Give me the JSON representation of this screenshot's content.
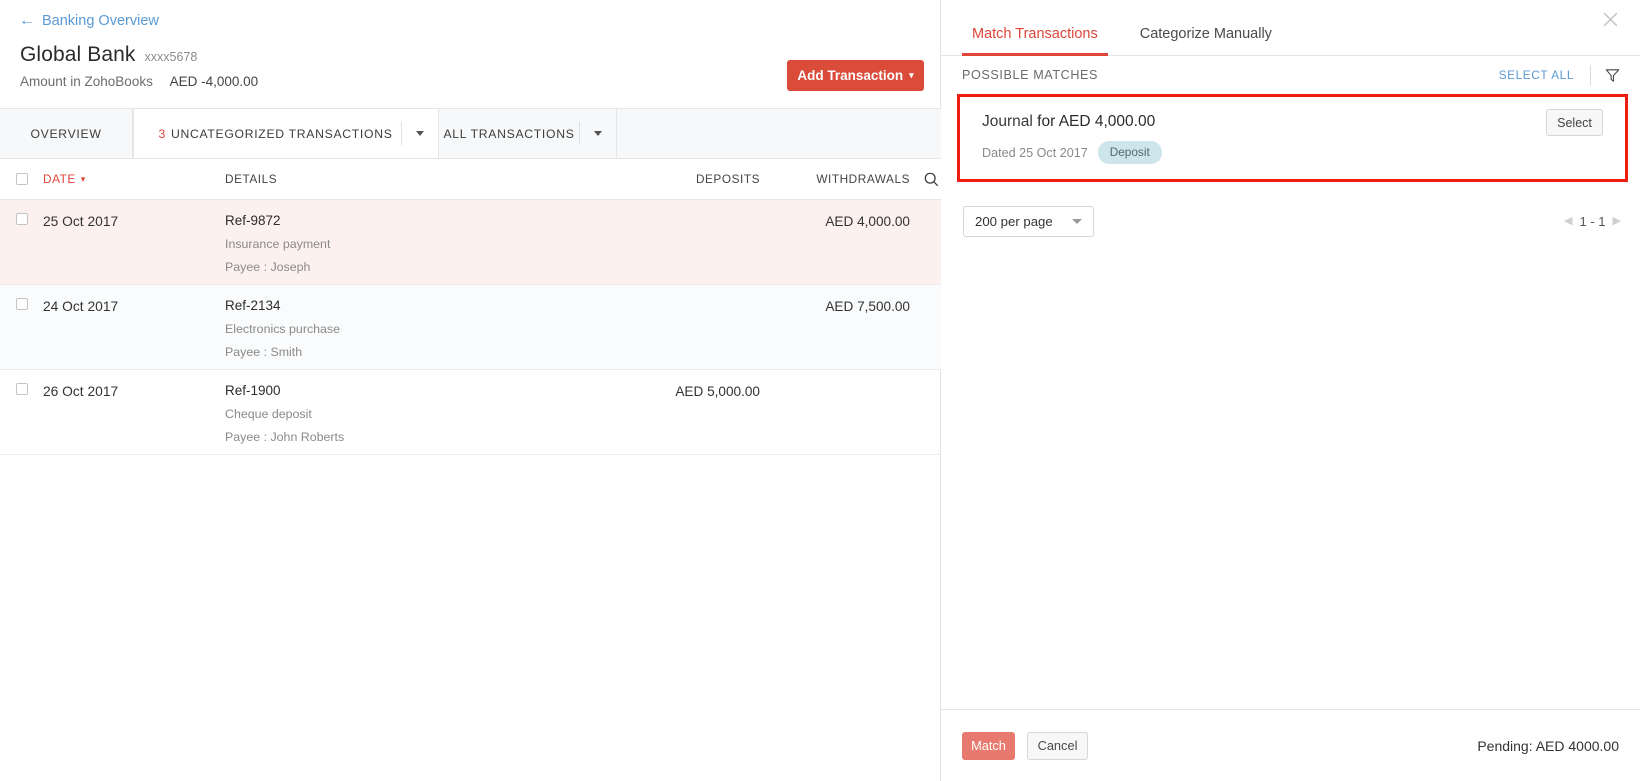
{
  "left_panel": {
    "breadcrumb": {
      "label": "Banking Overview",
      "icon": "back-arrow-icon"
    },
    "account": {
      "name": "Global Bank",
      "masked_number": "xxxx5678",
      "balance_label": "Amount in ZohoBooks",
      "balance_value": "AED -4,000.00"
    },
    "add_transaction": {
      "label": "Add Transaction",
      "caret": "▾",
      "color": "#db4b3a"
    },
    "tabs": [
      {
        "label": "OVERVIEW",
        "active": false,
        "has_caret": false
      },
      {
        "label": "UNCATEGORIZED TRANSACTIONS",
        "count": "3",
        "active": true,
        "has_caret": true
      },
      {
        "label": "ALL TRANSACTIONS",
        "active": false,
        "has_caret": true
      }
    ],
    "table": {
      "columns": {
        "date": "DATE",
        "details": "DETAILS",
        "deposits": "DEPOSITS",
        "withdrawals": "WITHDRAWALS"
      },
      "sort_indicator": "▾",
      "search_icon": "search-icon",
      "rows": [
        {
          "date": "25 Oct 2017",
          "ref": "Ref-9872",
          "description": "Insurance payment",
          "payee": "Payee : Joseph",
          "deposit": "",
          "withdrawal": "AED 4,000.00",
          "highlighted": true
        },
        {
          "date": "24 Oct 2017",
          "ref": "Ref-2134",
          "description": "Electronics purchase",
          "payee": "Payee : Smith",
          "deposit": "",
          "withdrawal": "AED 7,500.00",
          "highlighted": false
        },
        {
          "date": "26 Oct 2017",
          "ref": "Ref-1900",
          "description": "Cheque deposit",
          "payee": "Payee : John Roberts",
          "deposit": "AED 5,000.00",
          "withdrawal": "",
          "highlighted": false
        }
      ]
    }
  },
  "right_panel": {
    "tabs": [
      {
        "label": "Match Transactions",
        "active": true
      },
      {
        "label": "Categorize Manually",
        "active": false
      }
    ],
    "close_icon": "close-icon",
    "possible_matches": {
      "section_label": "POSSIBLE MATCHES",
      "select_all_label": "SELECT ALL",
      "filter_icon": "filter-funnel-icon",
      "highlight_color": "#f01c12",
      "cards": [
        {
          "type": "Journal",
          "for_text": "for AED 4,000.00",
          "dated": "Dated 25 Oct 2017",
          "badge": "Deposit",
          "badge_color": "#cfe5ec",
          "select_label": "Select"
        }
      ]
    },
    "pagination": {
      "per_page": "200 per page",
      "range": "1 - 1",
      "prev_icon": "chevron-left-icon",
      "next_icon": "chevron-right-icon"
    },
    "footer": {
      "match_label": "Match",
      "cancel_label": "Cancel",
      "pending_text": "Pending: AED 4000.00"
    }
  }
}
